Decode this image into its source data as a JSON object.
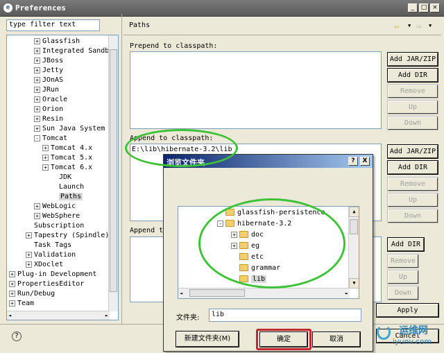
{
  "window": {
    "title": "Preferences",
    "logo": "e"
  },
  "filter": {
    "value": "type filter text"
  },
  "tree": [
    {
      "label": "Glassfish",
      "indent": 3,
      "exp": "+"
    },
    {
      "label": "Integrated Sandb",
      "indent": 3,
      "exp": "+"
    },
    {
      "label": "JBoss",
      "indent": 3,
      "exp": "+"
    },
    {
      "label": "Jetty",
      "indent": 3,
      "exp": "+"
    },
    {
      "label": "JOnAS",
      "indent": 3,
      "exp": "+"
    },
    {
      "label": "JRun",
      "indent": 3,
      "exp": "+"
    },
    {
      "label": "Oracle",
      "indent": 3,
      "exp": "+"
    },
    {
      "label": "Orion",
      "indent": 3,
      "exp": "+"
    },
    {
      "label": "Resin",
      "indent": 3,
      "exp": "+"
    },
    {
      "label": "Sun Java System",
      "indent": 3,
      "exp": "+"
    },
    {
      "label": "Tomcat",
      "indent": 3,
      "exp": "-"
    },
    {
      "label": "Tomcat  4.x",
      "indent": 4,
      "exp": "+"
    },
    {
      "label": "Tomcat  5.x",
      "indent": 4,
      "exp": "+"
    },
    {
      "label": "Tomcat  6.x",
      "indent": 4,
      "exp": "+"
    },
    {
      "label": "JDK",
      "indent": 5,
      "exp": ""
    },
    {
      "label": "Launch",
      "indent": 5,
      "exp": ""
    },
    {
      "label": "Paths",
      "indent": 5,
      "exp": "",
      "selected": true
    },
    {
      "label": "WebLogic",
      "indent": 3,
      "exp": "+"
    },
    {
      "label": "WebSphere",
      "indent": 3,
      "exp": "+"
    },
    {
      "label": "Subscription",
      "indent": 2,
      "exp": ""
    },
    {
      "label": "Tapestry (Spindle)",
      "indent": 2,
      "exp": "+"
    },
    {
      "label": "Task Tags",
      "indent": 2,
      "exp": ""
    },
    {
      "label": "Validation",
      "indent": 2,
      "exp": "+"
    },
    {
      "label": "XDoclet",
      "indent": 2,
      "exp": "+"
    },
    {
      "label": "Plug-in Development",
      "indent": 0,
      "exp": "+"
    },
    {
      "label": "PropertiesEditor",
      "indent": 0,
      "exp": "+"
    },
    {
      "label": "Run/Debug",
      "indent": 0,
      "exp": "+"
    },
    {
      "label": "Team",
      "indent": 0,
      "exp": "+"
    }
  ],
  "page": {
    "title": "Paths",
    "prepend_label": "Prepend to classpath:",
    "append_label": "Append to classpath:",
    "append_value": "E:\\lib\\hibernate-3.2\\lib",
    "append3_label": "Append to"
  },
  "buttons": {
    "add_jar": "Add JAR/ZIP",
    "add_dir": "Add DIR",
    "remove": "Remove",
    "up": "Up",
    "down": "Down",
    "apply": "Apply",
    "cancel": "Cancel"
  },
  "dialog": {
    "title": "浏览文件夹",
    "help": "?",
    "close": "X",
    "folders": [
      {
        "label": "glassfish-persistence",
        "exp": ""
      },
      {
        "label": "hibernate-3.2",
        "exp": "-"
      },
      {
        "label": "doc",
        "exp": "+"
      },
      {
        "label": "eg",
        "exp": "+"
      },
      {
        "label": "etc",
        "exp": ""
      },
      {
        "label": "grammar",
        "exp": ""
      },
      {
        "label": "lib",
        "exp": "",
        "selected": true
      }
    ],
    "folder_label": "文件夹:",
    "folder_value": "lib",
    "new_folder": "新建文件夹(M)",
    "ok": "确定",
    "cancel": "取消"
  },
  "watermark": {
    "cn": "运维网",
    "url": "iyunv.com"
  }
}
